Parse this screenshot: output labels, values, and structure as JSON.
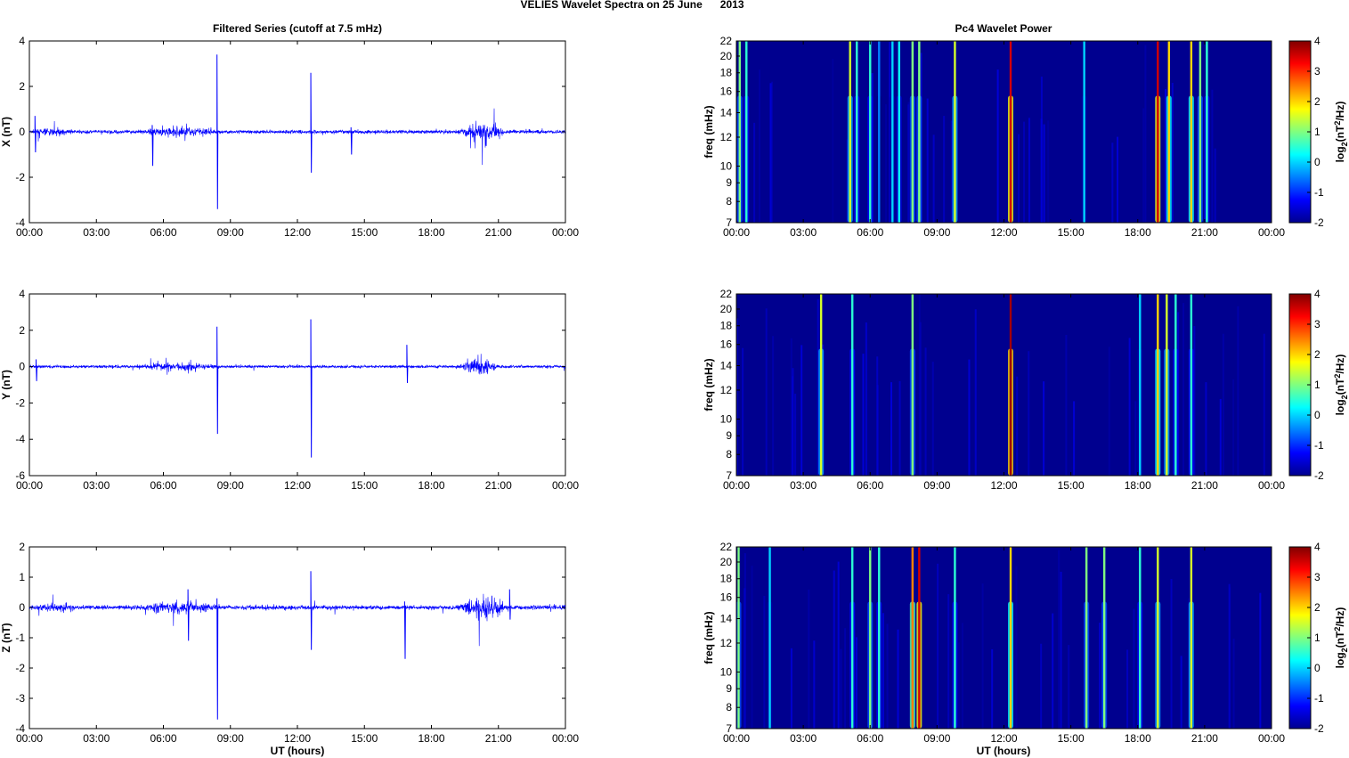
{
  "title": "VELIES Wavelet Spectra on 25 June      2013",
  "left_title": "Filtered Series (cutoff at 7.5 mHz)",
  "right_title": "Pc4 Wavelet Power",
  "xlabel": "UT (hours)",
  "x_ticks": [
    "00:00",
    "03:00",
    "06:00",
    "09:00",
    "12:00",
    "15:00",
    "18:00",
    "21:00",
    "00:00"
  ],
  "freq_ticks": [
    7,
    8,
    9,
    10,
    12,
    14,
    16,
    18,
    20,
    22
  ],
  "freq_label": "freq (mHz)",
  "colorbar": {
    "label": "log2(nT2/Hz)",
    "ticks": [
      -2,
      -1,
      0,
      1,
      2,
      3,
      4
    ],
    "range": [
      -2,
      4
    ],
    "colormap": "jet",
    "background": "#00008f"
  },
  "line_color": "#0000ff",
  "chart_data": [
    {
      "type": "line",
      "ylabel": "X (nT)",
      "ylim": [
        -4,
        4
      ],
      "yticks": [
        -4,
        -2,
        0,
        2,
        4
      ],
      "xlim": [
        0,
        24
      ],
      "noise": 0.08,
      "bursts": [
        {
          "from": 5.0,
          "to": 8.5,
          "amp": 0.45
        },
        {
          "from": 19.2,
          "to": 21.3,
          "amp": 1.1
        },
        {
          "from": 0.3,
          "to": 2.0,
          "amp": 0.25
        }
      ],
      "spikes": [
        {
          "t": 8.4,
          "max": 3.4,
          "min": -3.4
        },
        {
          "t": 12.6,
          "max": 2.6,
          "min": -1.8
        },
        {
          "t": 5.5,
          "max": 0.3,
          "min": -1.5
        },
        {
          "t": 14.4,
          "max": 0.2,
          "min": -1.0
        },
        {
          "t": 0.25,
          "max": 0.7,
          "min": -0.9
        }
      ]
    },
    {
      "type": "line",
      "ylabel": "Y (nT)",
      "ylim": [
        -6,
        4
      ],
      "yticks": [
        -6,
        -4,
        -2,
        0,
        2,
        4
      ],
      "xlim": [
        0,
        24
      ],
      "noise": 0.08,
      "bursts": [
        {
          "from": 5.0,
          "to": 8.5,
          "amp": 0.5
        },
        {
          "from": 19.2,
          "to": 21.0,
          "amp": 1.2
        }
      ],
      "spikes": [
        {
          "t": 8.4,
          "max": 2.2,
          "min": -3.7
        },
        {
          "t": 12.6,
          "max": 2.6,
          "min": -5.0
        },
        {
          "t": 16.9,
          "max": 1.2,
          "min": -0.9
        },
        {
          "t": 0.3,
          "max": 0.4,
          "min": -0.8
        }
      ]
    },
    {
      "type": "line",
      "ylabel": "Z (nT)",
      "ylim": [
        -4,
        2
      ],
      "yticks": [
        -4,
        -3,
        -2,
        -1,
        0,
        1,
        2
      ],
      "xlim": [
        0,
        24
      ],
      "noise": 0.07,
      "bursts": [
        {
          "from": 5.0,
          "to": 8.6,
          "amp": 0.45
        },
        {
          "from": 19.1,
          "to": 21.5,
          "amp": 1.0
        },
        {
          "from": 0.3,
          "to": 2.0,
          "amp": 0.3
        }
      ],
      "spikes": [
        {
          "t": 8.4,
          "max": 0.3,
          "min": -3.7
        },
        {
          "t": 12.6,
          "max": 1.2,
          "min": -1.4
        },
        {
          "t": 16.8,
          "max": 0.2,
          "min": -1.7
        },
        {
          "t": 21.5,
          "max": 0.6,
          "min": -0.4
        },
        {
          "t": 7.1,
          "max": 0.6,
          "min": -1.1
        }
      ]
    }
  ],
  "spectra": [
    {
      "type": "heatmap",
      "events": [
        {
          "t": 0.15,
          "p": 1
        },
        {
          "t": 0.45,
          "p": 0.5
        },
        {
          "t": 5.1,
          "p": 1.5
        },
        {
          "t": 5.4,
          "p": 0.5
        },
        {
          "t": 6.0,
          "p": 0.5
        },
        {
          "t": 6.4,
          "p": -0.5
        },
        {
          "t": 7.0,
          "p": 0
        },
        {
          "t": 7.3,
          "p": 0.3
        },
        {
          "t": 7.9,
          "p": 1
        },
        {
          "t": 8.2,
          "p": 1
        },
        {
          "t": 9.8,
          "p": 1.5
        },
        {
          "t": 12.3,
          "p": 3.5
        },
        {
          "t": 15.6,
          "p": 0
        },
        {
          "t": 18.9,
          "p": 3.5
        },
        {
          "t": 19.4,
          "p": 2
        },
        {
          "t": 20.4,
          "p": 2
        },
        {
          "t": 20.8,
          "p": 1
        },
        {
          "t": 21.1,
          "p": 0.5
        }
      ]
    },
    {
      "type": "heatmap",
      "events": [
        {
          "t": 3.8,
          "p": 1.5
        },
        {
          "t": 5.2,
          "p": 0.5
        },
        {
          "t": 7.9,
          "p": 1
        },
        {
          "t": 12.3,
          "p": 3.8
        },
        {
          "t": 18.1,
          "p": 0
        },
        {
          "t": 18.9,
          "p": 2
        },
        {
          "t": 19.3,
          "p": 1.5
        },
        {
          "t": 19.7,
          "p": 0.5
        },
        {
          "t": 20.4,
          "p": 0.5
        }
      ]
    },
    {
      "type": "heatmap",
      "events": [
        {
          "t": 0.1,
          "p": 1
        },
        {
          "t": 1.5,
          "p": 0
        },
        {
          "t": 5.2,
          "p": 0.5
        },
        {
          "t": 6.0,
          "p": 1
        },
        {
          "t": 6.4,
          "p": 0.5
        },
        {
          "t": 7.9,
          "p": 2.5
        },
        {
          "t": 8.2,
          "p": 3.5
        },
        {
          "t": 9.8,
          "p": 0.5
        },
        {
          "t": 12.3,
          "p": 2
        },
        {
          "t": 15.7,
          "p": 1
        },
        {
          "t": 16.5,
          "p": 1
        },
        {
          "t": 18.1,
          "p": 0.5
        },
        {
          "t": 18.9,
          "p": 1.5
        },
        {
          "t": 20.4,
          "p": 1.5
        }
      ]
    }
  ]
}
